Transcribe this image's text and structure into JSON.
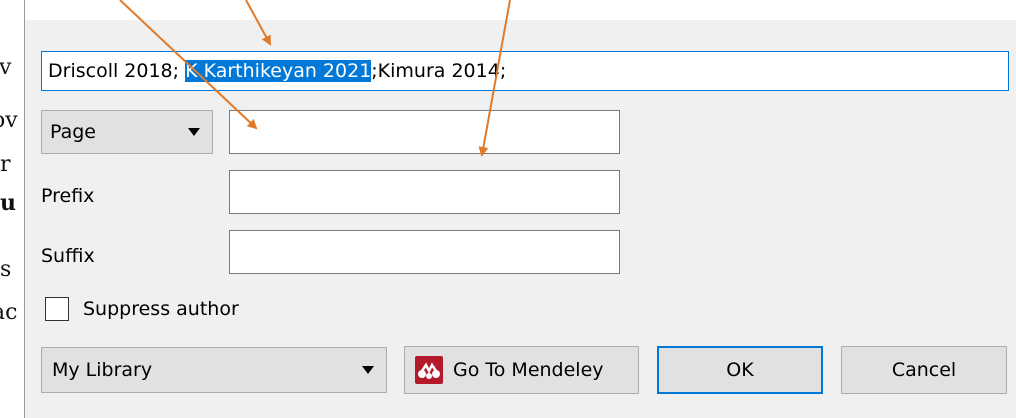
{
  "background_doc": {
    "fragments": [
      "iv",
      "ov",
      "r",
      "u",
      "s",
      "ac"
    ]
  },
  "citation": {
    "before": "Driscoll 2018; ",
    "selected": "K Karthikeyan 2021",
    "after": ";Kimura 2014;"
  },
  "locator": {
    "selected": "Page"
  },
  "labels": {
    "prefix": "Prefix",
    "suffix": "Suffix"
  },
  "suppress_author": {
    "label": "Suppress author",
    "checked": false
  },
  "library": {
    "selected": "My Library"
  },
  "buttons": {
    "mendeley": "Go To Mendeley",
    "ok": "OK",
    "cancel": "Cancel"
  },
  "colors": {
    "selection": "#0078d7",
    "arrow": "#e07a2a",
    "mendeley_red": "#b3182b",
    "dialog_bg": "#f0f0f0"
  }
}
